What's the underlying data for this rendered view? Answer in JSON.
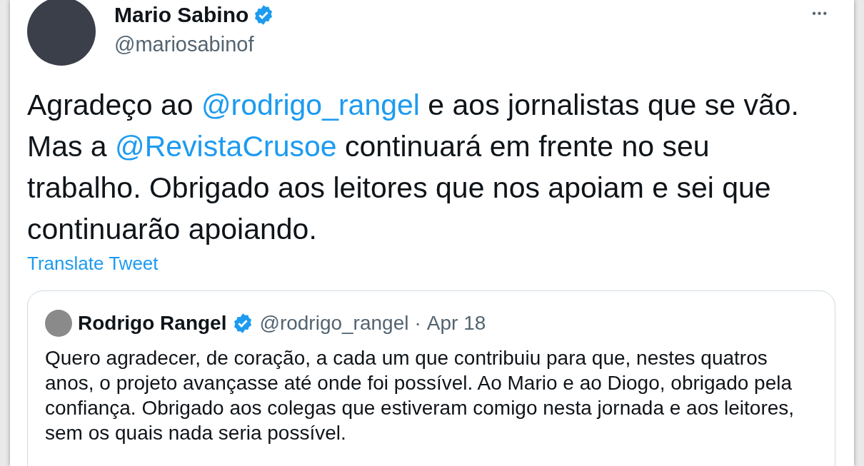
{
  "author": {
    "name": "Mario Sabino",
    "verified": true,
    "handle": "@mariosabinof"
  },
  "more_menu": "•••",
  "tweet_text": [
    {
      "kind": "text",
      "text": "Agradeço ao "
    },
    {
      "kind": "mention",
      "text": "@rodrigo_rangel"
    },
    {
      "kind": "text",
      "text": " e aos jornalistas que se vão. Mas a "
    },
    {
      "kind": "mention",
      "text": "@RevistaCrusoe"
    },
    {
      "kind": "text",
      "text": " continuará em frente no seu trabalho. Obrigado aos leitores que nos apoiam e sei que continuarão apoiando."
    }
  ],
  "translate_link": "Translate Tweet",
  "quoted_tweet": {
    "name": "Rodrigo Rangel",
    "verified": true,
    "handle": "@rodrigo_rangel",
    "separator": "·",
    "date": "Apr 18",
    "text": "Quero agradecer, de coração, a cada um que contribuiu para que, nestes quatros anos, o projeto avançasse até onde foi possível. Ao Mario e ao Diogo, obrigado pela confiança. Obrigado aos colegas que estiveram comigo nesta jornada e aos leitores, sem os quais nada seria possível."
  }
}
